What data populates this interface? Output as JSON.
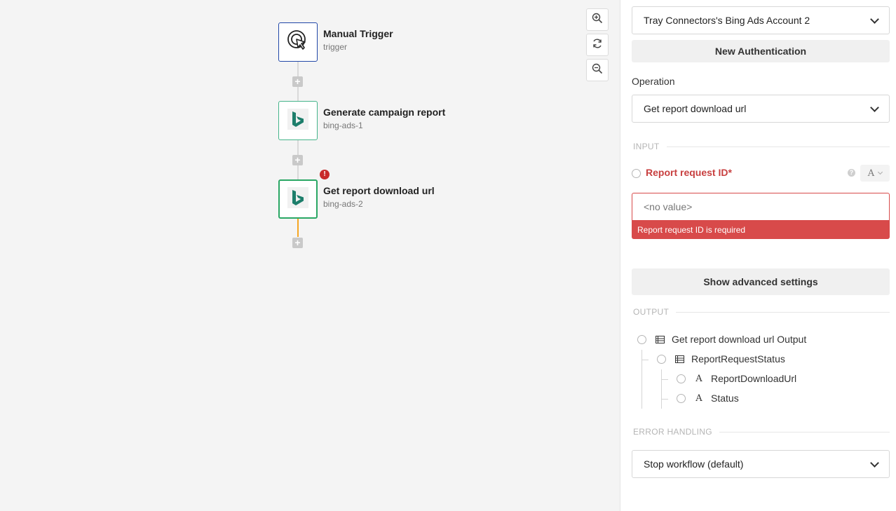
{
  "canvas": {
    "nodes": [
      {
        "title": "Manual Trigger",
        "subtitle": "trigger",
        "icon": "cursor-click-icon"
      },
      {
        "title": "Generate campaign report",
        "subtitle": "bing-ads-1",
        "icon": "bing-logo-icon"
      },
      {
        "title": "Get report download url",
        "subtitle": "bing-ads-2",
        "icon": "bing-logo-icon",
        "error": true
      }
    ],
    "add_step_symbol": "+",
    "error_symbol": "!",
    "zoom_controls": [
      "zoom-in-icon",
      "reset-zoom-icon",
      "zoom-out-icon"
    ]
  },
  "panel": {
    "auth_select": {
      "value": "Tray Connectors's Bing Ads Account 2"
    },
    "new_auth_button": "New Authentication",
    "operation_label": "Operation",
    "operation_select": {
      "value": "Get report download url"
    },
    "input_section": "INPUT",
    "report_field": {
      "label": "Report request ID*",
      "placeholder": "<no value>",
      "error": "Report request ID is required",
      "type_symbol": "A",
      "help_symbol": "?"
    },
    "advanced_button": "Show advanced settings",
    "output_section": "OUTPUT",
    "output_tree": {
      "root": "Get report download url Output",
      "child": "ReportRequestStatus",
      "leaves": [
        "ReportDownloadUrl",
        "Status"
      ],
      "leaf_type_symbol": "A"
    },
    "error_section": "ERROR HANDLING",
    "error_select": {
      "value": "Stop workflow (default)"
    }
  },
  "colors": {
    "trigger_border": "#2147a8",
    "bing_border": "#45b48a",
    "bing_green": "#1d7e6b",
    "error_red": "#d84a4a",
    "connector_orange": "#f5a623"
  }
}
